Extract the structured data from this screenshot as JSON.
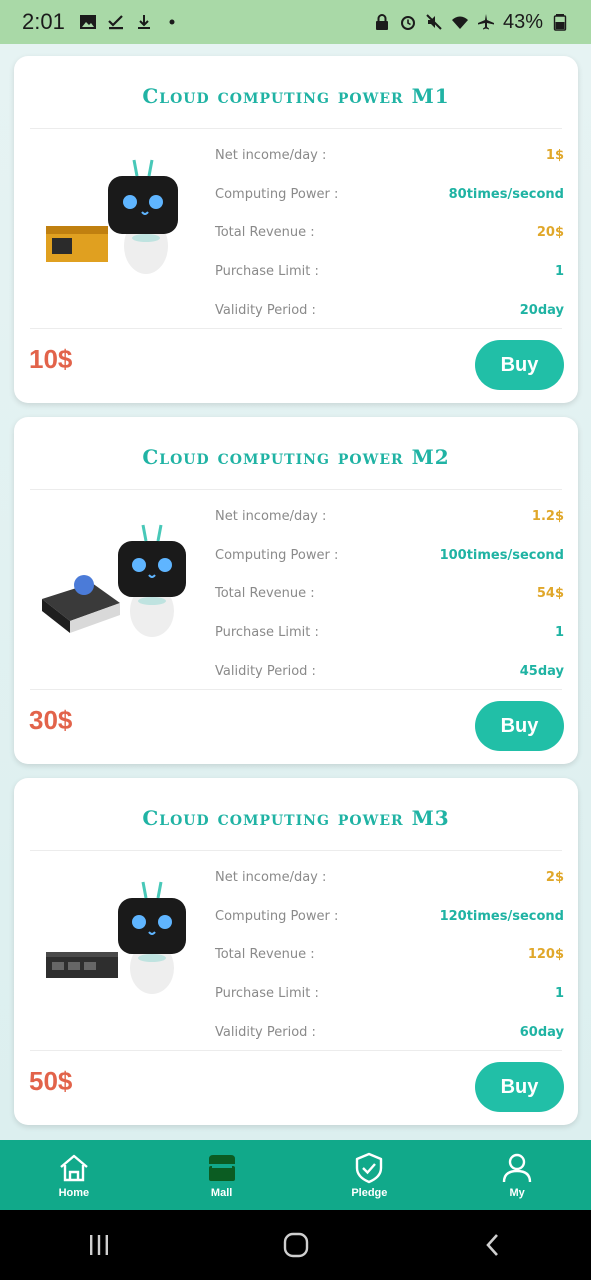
{
  "status_bar": {
    "time": "2:01",
    "battery": "43%"
  },
  "products": [
    {
      "title": "Cloud computing power M1",
      "price": "10$",
      "buy_label": "Buy",
      "specs": [
        {
          "label": "Net income/day :",
          "value": "1$",
          "color": "orange"
        },
        {
          "label": "Computing Power :",
          "value": "80times/second",
          "color": "teal"
        },
        {
          "label": "Total Revenue :",
          "value": "20$",
          "color": "orange"
        },
        {
          "label": "Purchase Limit :",
          "value": "1",
          "color": "teal"
        },
        {
          "label": "Validity Period :",
          "value": "20day",
          "color": "teal"
        }
      ]
    },
    {
      "title": "Cloud computing power M2",
      "price": "30$",
      "buy_label": "Buy",
      "specs": [
        {
          "label": "Net income/day :",
          "value": "1.2$",
          "color": "orange"
        },
        {
          "label": "Computing Power :",
          "value": "100times/second",
          "color": "teal"
        },
        {
          "label": "Total Revenue :",
          "value": "54$",
          "color": "orange"
        },
        {
          "label": "Purchase Limit :",
          "value": "1",
          "color": "teal"
        },
        {
          "label": "Validity Period :",
          "value": "45day",
          "color": "teal"
        }
      ]
    },
    {
      "title": "Cloud computing power M3",
      "price": "50$",
      "buy_label": "Buy",
      "specs": [
        {
          "label": "Net income/day :",
          "value": "2$",
          "color": "orange"
        },
        {
          "label": "Computing Power :",
          "value": "120times/second",
          "color": "teal"
        },
        {
          "label": "Total Revenue :",
          "value": "120$",
          "color": "orange"
        },
        {
          "label": "Purchase Limit :",
          "value": "1",
          "color": "teal"
        },
        {
          "label": "Validity Period :",
          "value": "60day",
          "color": "teal"
        }
      ]
    }
  ],
  "tabs": [
    {
      "label": "Home",
      "icon": "home-icon"
    },
    {
      "label": "Mall",
      "icon": "store-icon",
      "active": true
    },
    {
      "label": "Pledge",
      "icon": "shield-check-icon"
    },
    {
      "label": "My",
      "icon": "user-icon"
    }
  ],
  "colors": {
    "accent": "#21bfa7",
    "title": "#20b3a4",
    "price": "#e2634a",
    "value_orange": "#e0a72a",
    "value_teal": "#1fb3a3",
    "tab_bar": "#11a98a",
    "status_bar": "#a9d9a7"
  }
}
